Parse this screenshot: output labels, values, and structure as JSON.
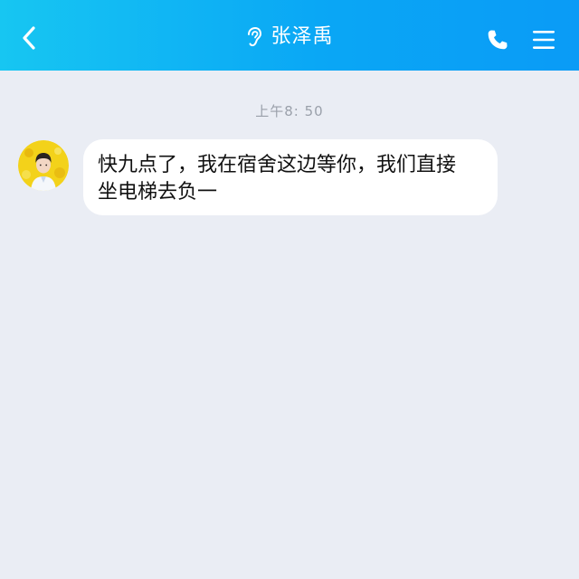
{
  "header": {
    "title": "张泽禹",
    "back_icon": "chevron-left-icon",
    "status_icon": "ear-icon",
    "call_icon": "phone-icon",
    "menu_icon": "menu-icon",
    "gradient_start": "#17c6f2",
    "gradient_end": "#0a9bf6"
  },
  "chat": {
    "timestamp": "上午8: 50",
    "messages": [
      {
        "sender": "contact",
        "avatar_icon": "avatar",
        "lines": [
          "快九点了，我在宿舍这边等你，我们直接",
          "坐电梯去负一"
        ]
      }
    ]
  },
  "colors": {
    "background": "#eaedf4",
    "bubble": "#ffffff",
    "timestamp": "#9aa0aa"
  }
}
